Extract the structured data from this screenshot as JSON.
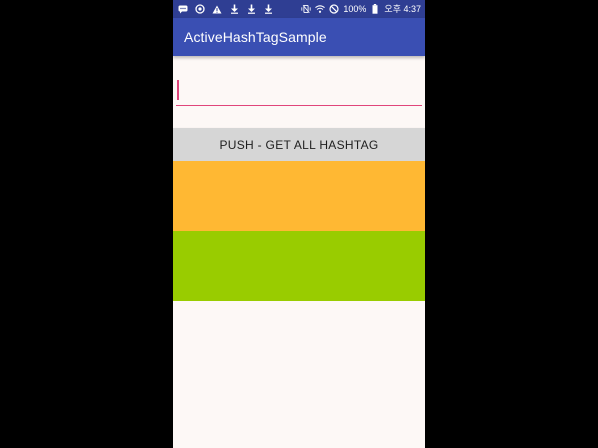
{
  "status_bar": {
    "battery_percent": "100%",
    "time": "오후 4:37",
    "left_icons": [
      "chat-icon",
      "sync-icon",
      "warning-icon",
      "download-icon",
      "download-icon",
      "download-icon"
    ],
    "right_icons": [
      "vibrate-icon",
      "wifi-icon",
      "do-not-disturb-icon",
      "battery-icon"
    ]
  },
  "app_bar": {
    "title": "ActiveHashTagSample",
    "color": "#3a4fb3"
  },
  "edit_text": {
    "value": "",
    "placeholder": "",
    "accent_color": "#e0457b"
  },
  "push_button": {
    "label": "PUSH - GET ALL HASHTAG"
  },
  "panels": {
    "orange_color": "#ffb833",
    "green_color": "#99cc00"
  }
}
